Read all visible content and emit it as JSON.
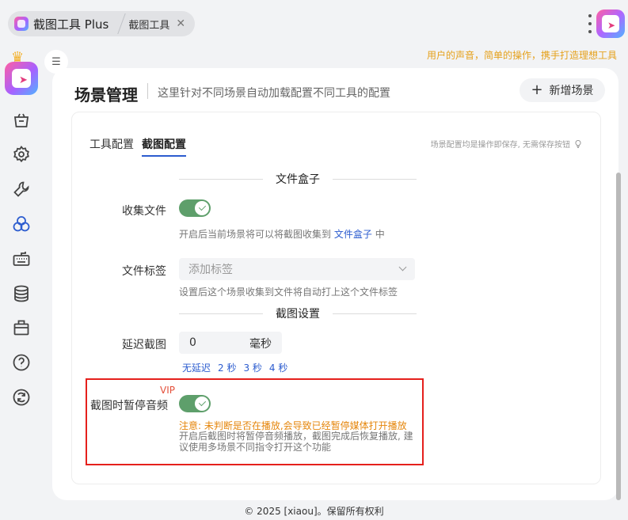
{
  "tabs": {
    "app_name": "截图工具 Plus",
    "current_tab": "截图工具"
  },
  "slogan": "用户的声音，简单的操作，携手打造理想工具",
  "sidebar": {
    "items": [
      {
        "icon": "bag-icon"
      },
      {
        "icon": "gear-icon"
      },
      {
        "icon": "wrench-icon"
      },
      {
        "icon": "three-circles-icon",
        "active": true
      },
      {
        "icon": "keyboard-icon"
      },
      {
        "icon": "database-icon"
      },
      {
        "icon": "briefcase-icon"
      },
      {
        "icon": "help-icon"
      },
      {
        "icon": "refresh-icon"
      }
    ]
  },
  "header": {
    "title": "场景管理",
    "description": "这里针对不同场景自动加载配置不同工具的配置",
    "add_button": "新增场景"
  },
  "subtabs": [
    "工具配置",
    "截图配置"
  ],
  "autosave_note": "场景配置均是操作即保存, 无需保存按钮",
  "file_box": {
    "section_title": "文件盒子",
    "collect_label": "收集文件",
    "collect_on": true,
    "collect_hint_prefix": "开启后当前场景将可以将截图收集到",
    "collect_hint_link": "文件盒子",
    "collect_hint_suffix": "中",
    "tag_label": "文件标签",
    "tag_placeholder": "添加标签",
    "tag_hint": "设置后这个场景收集到文件将自动打上这个文件标签"
  },
  "screenshot": {
    "section_title": "截图设置",
    "delay_label": "延迟截图",
    "delay_value": "0",
    "delay_unit": "毫秒",
    "quick_options": [
      "无延迟",
      "2 秒",
      "3 秒",
      "4 秒"
    ],
    "pause_label": "截图时暂停音频",
    "vip_tag": "VIP",
    "pause_on": true,
    "pause_warning": "注意: 未判断是否在播放,会导致已经暂停媒体打开播放",
    "pause_hint_line1": "开启后截图时将暂停音频播放，截图完成后恢复播放, 建",
    "pause_hint_line2": "议使用多场景不同指令打开这个功能"
  },
  "footer": "© 2025 [xiaou]。保留所有权利"
}
